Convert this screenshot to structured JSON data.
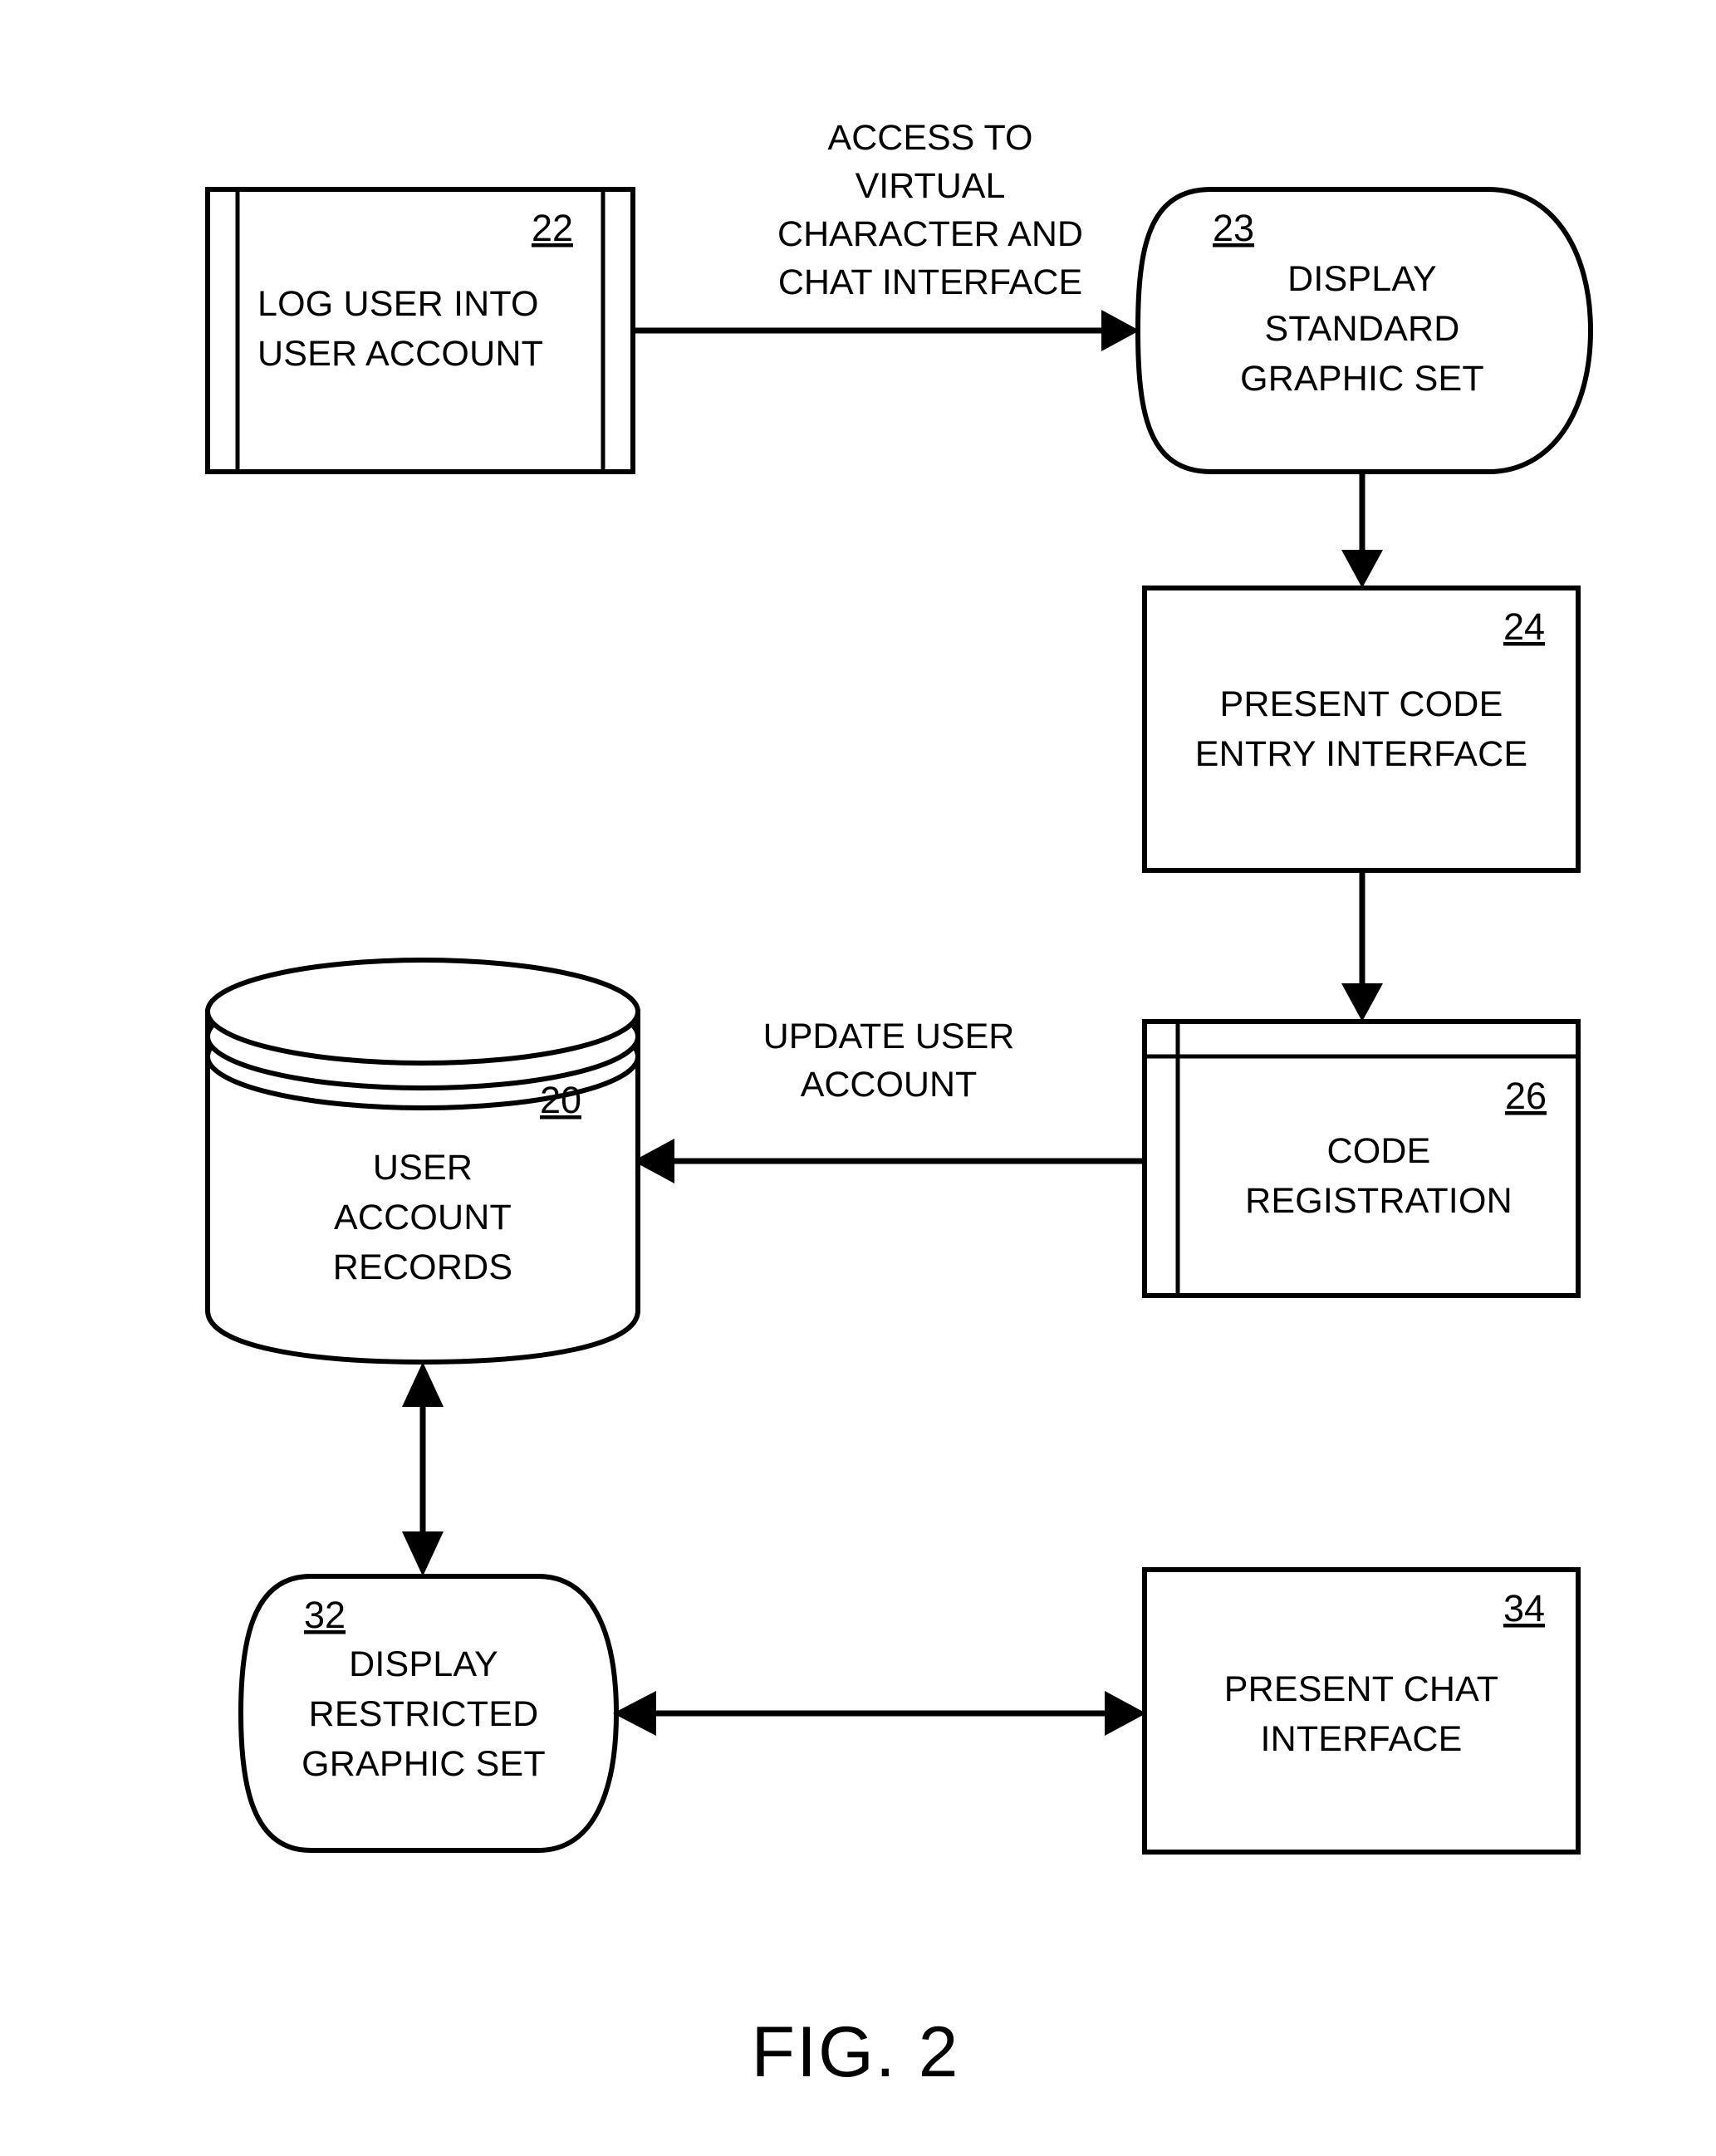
{
  "figure": {
    "caption": "FIG. 2",
    "nodes": {
      "log_user": {
        "ref": "22",
        "shape": "predefined-process",
        "lines": [
          "LOG USER INTO",
          "USER ACCOUNT"
        ]
      },
      "display_standard": {
        "ref": "23",
        "shape": "display-blob",
        "lines": [
          "DISPLAY",
          "STANDARD",
          "GRAPHIC SET"
        ]
      },
      "code_entry": {
        "ref": "24",
        "shape": "rectangle",
        "lines": [
          "PRESENT CODE",
          "ENTRY INTERFACE"
        ]
      },
      "code_registration": {
        "ref": "26",
        "shape": "module",
        "lines": [
          "CODE",
          "REGISTRATION"
        ]
      },
      "user_records": {
        "ref": "20",
        "shape": "database-cylinder",
        "lines": [
          "USER",
          "ACCOUNT",
          "RECORDS"
        ]
      },
      "display_restricted": {
        "ref": "32",
        "shape": "display-blob",
        "lines": [
          "DISPLAY",
          "RESTRICTED",
          "GRAPHIC SET"
        ]
      },
      "chat_interface": {
        "ref": "34",
        "shape": "rectangle",
        "lines": [
          "PRESENT CHAT",
          "INTERFACE"
        ]
      }
    },
    "edges": {
      "access_label": {
        "lines": [
          "ACCESS TO",
          "VIRTUAL",
          "CHARACTER AND",
          "CHAT INTERFACE"
        ],
        "from": "22",
        "to": "23",
        "style": "single-arrow-right"
      },
      "update_label": {
        "lines": [
          "UPDATE USER",
          "ACCOUNT"
        ],
        "from": "26",
        "to": "20",
        "style": "single-arrow-left"
      },
      "std_to_entry": {
        "lines": [],
        "from": "23",
        "to": "24",
        "style": "single-arrow-down"
      },
      "entry_to_reg": {
        "lines": [],
        "from": "24",
        "to": "26",
        "style": "single-arrow-down"
      },
      "records_to_restricted": {
        "lines": [],
        "from": "20",
        "to": "32",
        "style": "double-arrow-vertical"
      },
      "restricted_to_chat": {
        "lines": [],
        "from": "32",
        "to": "34",
        "style": "double-arrow-horizontal"
      }
    }
  },
  "colors": {
    "ink": "#000000",
    "paper": "#ffffff"
  }
}
